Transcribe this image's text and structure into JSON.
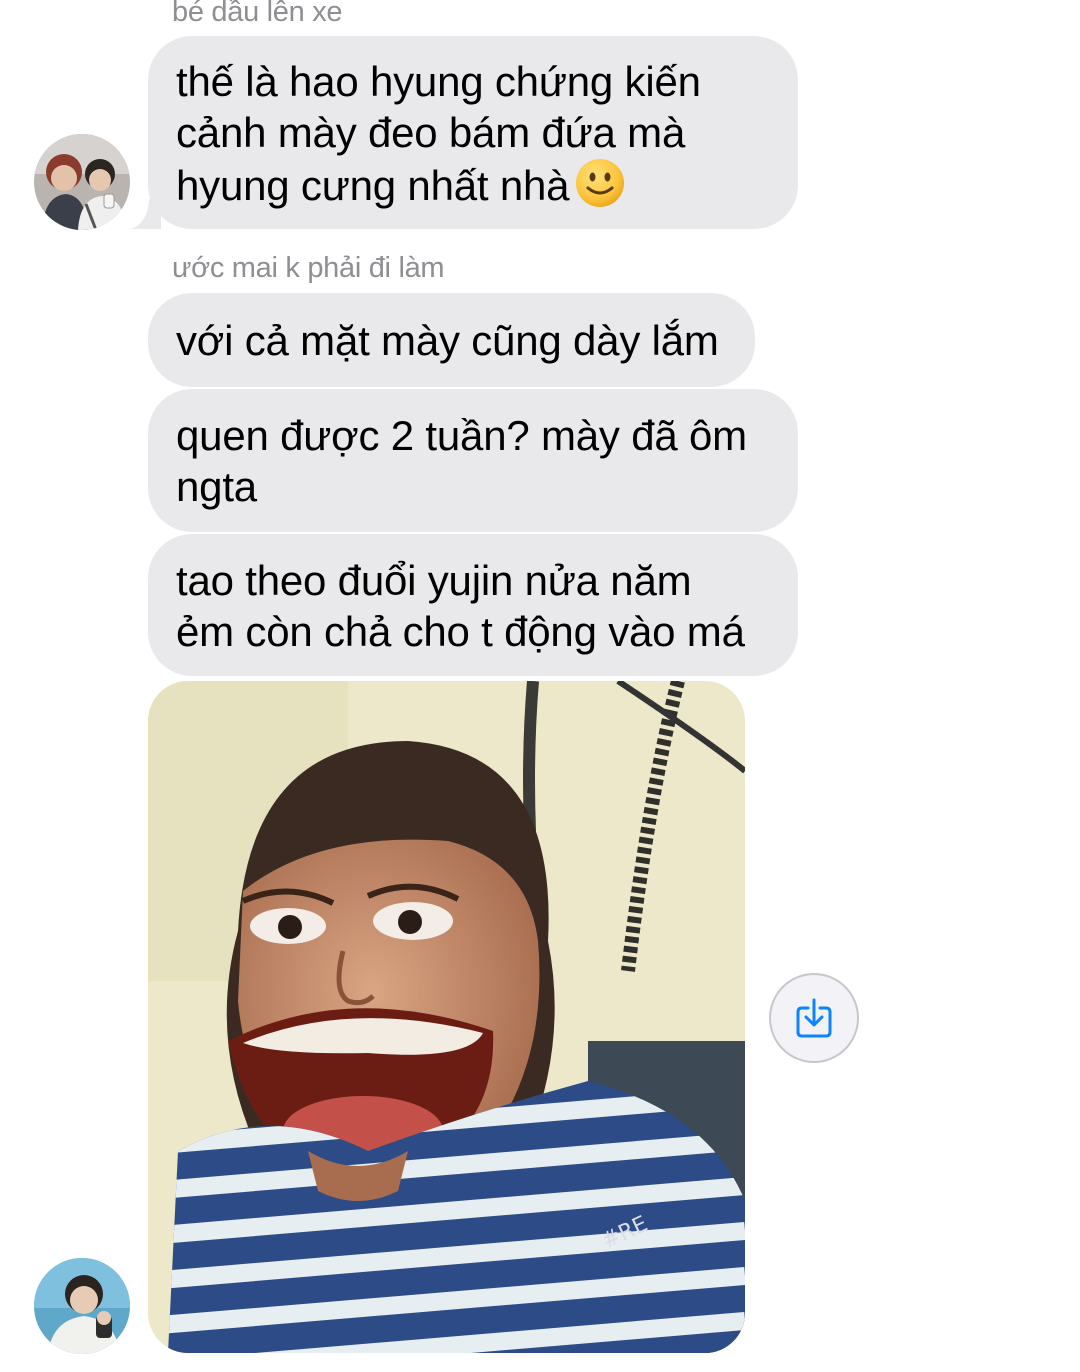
{
  "conversation": {
    "groups": [
      {
        "sender_name": "bé dầu lên xe",
        "messages": [
          {
            "lines": [
              "thế là hao hyung chứng kiến",
              "cảnh mày đeo bám đứa mà",
              "hyung cưng nhất nhà"
            ],
            "emoji": "slightly-smiling-face-icon"
          }
        ]
      },
      {
        "sender_name": "ước mai k phải đi làm",
        "messages": [
          {
            "lines": [
              "với cả mặt mày cũng dày lắm"
            ]
          },
          {
            "lines": [
              "quen được 2 tuần? mày đã ôm",
              "ngta"
            ]
          },
          {
            "lines": [
              "tao theo đuổi yujin nửa năm",
              "ẻm còn chả cho t động vào má"
            ]
          }
        ],
        "photo": {
          "description_icon": "photo-attachment",
          "shirt_print": "#RE"
        }
      }
    ]
  },
  "actions": {
    "save_icon": "download-to-device-icon"
  },
  "colors": {
    "incoming_bubble": "#e9e9eb",
    "sender_name": "#8e8e93",
    "accent": "#0a84ff"
  }
}
